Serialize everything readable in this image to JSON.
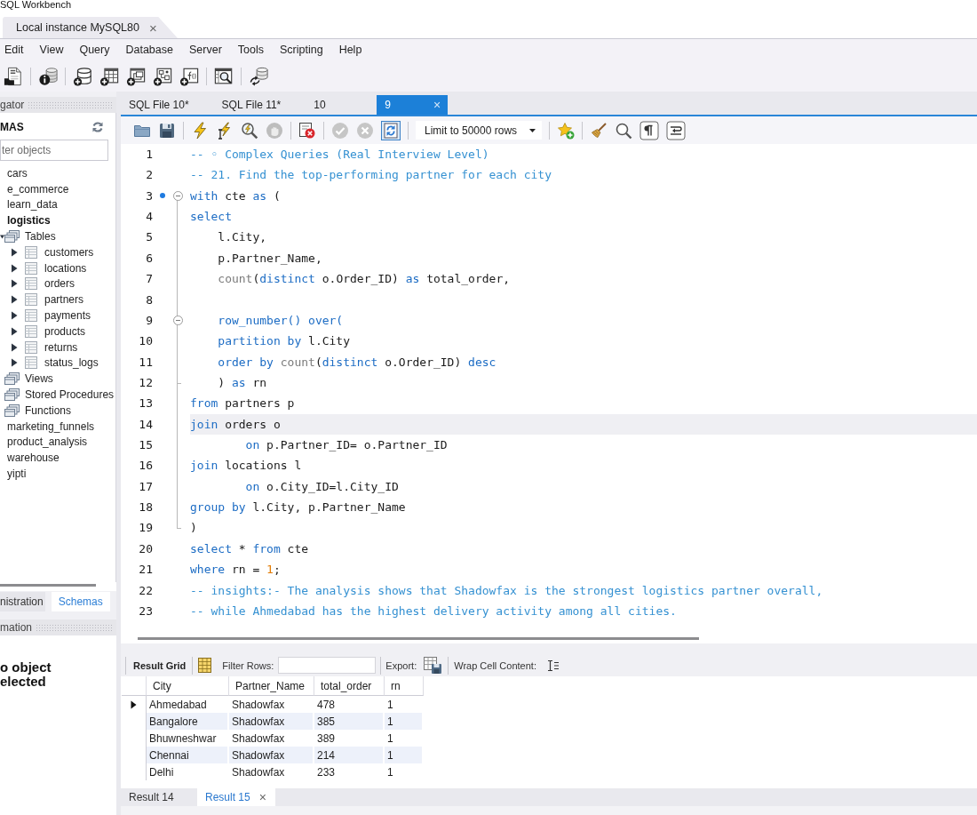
{
  "app": {
    "title": "SQL Workbench"
  },
  "connection_tabs": [
    {
      "label": "Local instance MySQL80",
      "close": "×",
      "selected": true
    }
  ],
  "menu": [
    "Edit",
    "View",
    "Query",
    "Database",
    "Server",
    "Tools",
    "Scripting",
    "Help"
  ],
  "navigator": {
    "header": "gator",
    "section": "MAS",
    "filter": {
      "placeholder": "ter objects"
    },
    "tree": [
      {
        "label": "cars",
        "kind": "schema",
        "default": false
      },
      {
        "label": "e_commerce",
        "kind": "schema",
        "default": false
      },
      {
        "label": "learn_data",
        "kind": "schema",
        "default": false
      },
      {
        "label": "logistics",
        "kind": "schema",
        "default": true,
        "children": [
          {
            "label": "Tables",
            "kind": "folder",
            "expanded": true,
            "children": [
              {
                "label": "customers",
                "kind": "table",
                "expanded": false
              },
              {
                "label": "locations",
                "kind": "table",
                "expanded": false
              },
              {
                "label": "orders",
                "kind": "table",
                "expanded": false
              },
              {
                "label": "partners",
                "kind": "table",
                "expanded": false
              },
              {
                "label": "payments",
                "kind": "table",
                "expanded": false
              },
              {
                "label": "products",
                "kind": "table",
                "expanded": false
              },
              {
                "label": "returns",
                "kind": "table",
                "expanded": false
              },
              {
                "label": "status_logs",
                "kind": "table",
                "expanded": false
              }
            ]
          },
          {
            "label": "Views",
            "kind": "folder"
          },
          {
            "label": "Stored Procedures",
            "kind": "folder"
          },
          {
            "label": "Functions",
            "kind": "folder"
          }
        ]
      },
      {
        "label": "marketing_funnels",
        "kind": "schema",
        "default": false
      },
      {
        "label": "product_analysis",
        "kind": "schema",
        "default": false
      },
      {
        "label": "warehouse",
        "kind": "schema",
        "default": false
      },
      {
        "label": "yipti",
        "kind": "schema",
        "default": false
      }
    ],
    "bottom_tabs": [
      {
        "label": "nistration",
        "selected": false
      },
      {
        "label": "Schemas",
        "selected": true
      }
    ],
    "info": {
      "header": "mation",
      "message": "o object elected"
    }
  },
  "editor_tabs": [
    {
      "label": "SQL File 10*",
      "selected": false
    },
    {
      "label": "SQL File 11*",
      "selected": false
    },
    {
      "label": "10",
      "selected": false
    },
    {
      "label": "9",
      "selected": true,
      "close": "×"
    }
  ],
  "editor_toolbar": {
    "executing": false,
    "autocommit": true,
    "limit": "Limit to 50000 rows"
  },
  "editor": {
    "lines": [
      {
        "number": "1",
        "kind": "plain",
        "marker": false,
        "current": false,
        "tokens": [
          {
            "kind": "comment",
            "text": "-- ◦ Complex Queries (Real Interview Level)"
          }
        ]
      },
      {
        "number": "2",
        "kind": "plain",
        "marker": false,
        "current": false,
        "tokens": [
          {
            "kind": "comment",
            "text": "-- 21. Find the top-performing partner for each city"
          }
        ]
      },
      {
        "number": "3",
        "kind": "open",
        "marker": true,
        "current": false,
        "tokens": [
          {
            "kind": "keyword",
            "text": "with"
          },
          {
            "kind": "plain",
            "text": " cte "
          },
          {
            "kind": "keyword",
            "text": "as"
          },
          {
            "kind": "plain",
            "text": " ("
          }
        ]
      },
      {
        "number": "4",
        "kind": "inner",
        "marker": false,
        "current": false,
        "tokens": [
          {
            "kind": "keyword",
            "text": "select"
          }
        ]
      },
      {
        "number": "5",
        "kind": "inner",
        "marker": false,
        "current": false,
        "tokens": [
          {
            "kind": "plain",
            "text": "    l.City,"
          }
        ]
      },
      {
        "number": "6",
        "kind": "inner",
        "marker": false,
        "current": false,
        "tokens": [
          {
            "kind": "plain",
            "text": "    p.Partner_Name,"
          }
        ]
      },
      {
        "number": "7",
        "kind": "inner",
        "marker": false,
        "current": false,
        "tokens": [
          {
            "kind": "function",
            "text": "    count"
          },
          {
            "kind": "plain",
            "text": "("
          },
          {
            "kind": "keyword",
            "text": "distinct"
          },
          {
            "kind": "plain",
            "text": " o.Order_ID) "
          },
          {
            "kind": "keyword",
            "text": "as"
          },
          {
            "kind": "plain",
            "text": " total_order,"
          }
        ]
      },
      {
        "number": "8",
        "kind": "inner",
        "marker": false
      },
      {
        "number": "9",
        "kind": "open",
        "marker": false,
        "current": false,
        "tokens": [
          {
            "kind": "keyword",
            "text": "    row_number() over("
          }
        ]
      },
      {
        "number": "10",
        "kind": "inner",
        "marker": false,
        "current": false,
        "tokens": [
          {
            "kind": "keyword",
            "text": "    partition by"
          },
          {
            "kind": "plain",
            "text": " l.City"
          }
        ]
      },
      {
        "number": "11",
        "kind": "inner",
        "marker": false,
        "current": false,
        "tokens": [
          {
            "kind": "keyword",
            "text": "    order by "
          },
          {
            "kind": "function",
            "text": "count"
          },
          {
            "kind": "plain",
            "text": "("
          },
          {
            "kind": "keyword",
            "text": "distinct"
          },
          {
            "kind": "plain",
            "text": " o.Order_ID) "
          },
          {
            "kind": "keyword",
            "text": "desc"
          }
        ]
      },
      {
        "number": "12",
        "kind": "close",
        "marker": false,
        "current": false,
        "tokens": [
          {
            "kind": "plain",
            "text": "    ) "
          },
          {
            "kind": "keyword",
            "text": "as"
          },
          {
            "kind": "plain",
            "text": " rn"
          }
        ]
      },
      {
        "number": "13",
        "kind": "inner",
        "marker": false,
        "current": false,
        "tokens": [
          {
            "kind": "keyword",
            "text": "from"
          },
          {
            "kind": "plain",
            "text": " partners p"
          }
        ]
      },
      {
        "number": "14",
        "kind": "inner",
        "marker": false,
        "current": true,
        "tokens": [
          {
            "kind": "keyword",
            "text": "join"
          },
          {
            "kind": "plain",
            "text": " orders o"
          }
        ]
      },
      {
        "number": "15",
        "kind": "inner",
        "marker": false,
        "current": false,
        "tokens": [
          {
            "kind": "keyword",
            "text": "        on"
          },
          {
            "kind": "plain",
            "text": " p.Partner_ID= o.Partner_ID"
          }
        ]
      },
      {
        "number": "16",
        "kind": "inner",
        "marker": false,
        "current": false,
        "tokens": [
          {
            "kind": "keyword",
            "text": "join"
          },
          {
            "kind": "plain",
            "text": " locations l"
          }
        ]
      },
      {
        "number": "17",
        "kind": "inner",
        "marker": false,
        "current": false,
        "tokens": [
          {
            "kind": "keyword",
            "text": "        on"
          },
          {
            "kind": "plain",
            "text": " o.City_ID=l.City_ID"
          }
        ]
      },
      {
        "number": "18",
        "kind": "inner",
        "marker": false,
        "current": false,
        "tokens": [
          {
            "kind": "keyword",
            "text": "group by"
          },
          {
            "kind": "plain",
            "text": " l.City, p.Partner_Name"
          }
        ]
      },
      {
        "number": "19",
        "kind": "close",
        "marker": false,
        "current": false,
        "tokens": [
          {
            "kind": "plain",
            "text": ")"
          }
        ]
      },
      {
        "number": "20",
        "kind": "plain",
        "marker": false,
        "current": false,
        "tokens": [
          {
            "kind": "keyword",
            "text": "select"
          },
          {
            "kind": "plain",
            "text": " * "
          },
          {
            "kind": "keyword",
            "text": "from"
          },
          {
            "kind": "plain",
            "text": " cte"
          }
        ]
      },
      {
        "number": "21",
        "kind": "plain",
        "marker": false,
        "current": false,
        "tokens": [
          {
            "kind": "keyword",
            "text": "where"
          },
          {
            "kind": "plain",
            "text": " rn = "
          },
          {
            "kind": "number",
            "text": "1"
          },
          {
            "kind": "plain",
            "text": ";"
          }
        ]
      },
      {
        "number": "22",
        "kind": "plain",
        "marker": false,
        "current": false,
        "tokens": [
          {
            "kind": "comment",
            "text": "-- insights:- The analysis shows that Shadowfax is the strongest logistics partner overall,"
          }
        ]
      },
      {
        "number": "23",
        "kind": "plain",
        "marker": false,
        "current": false,
        "tokens": [
          {
            "kind": "comment",
            "text": "-- while Ahmedabad has the highest delivery activity among all cities."
          }
        ]
      }
    ]
  },
  "results": {
    "toolbar": {
      "view": "Result Grid",
      "filter_label": "Filter Rows:",
      "export_label": "Export:",
      "wrap_label": "Wrap Cell Content:"
    },
    "columns": [
      "City",
      "Partner_Name",
      "total_order",
      "rn"
    ],
    "rows": [
      {
        "cells": [
          "Ahmedabad",
          "Shadowfax",
          "478",
          "1"
        ],
        "current": true
      },
      {
        "cells": [
          "Bangalore",
          "Shadowfax",
          "385",
          "1"
        ],
        "current": false
      },
      {
        "cells": [
          "Bhuwneshwar",
          "Shadowfax",
          "389",
          "1"
        ],
        "current": false
      },
      {
        "cells": [
          "Chennai",
          "Shadowfax",
          "214",
          "1"
        ],
        "current": false
      },
      {
        "cells": [
          "Delhi",
          "Shadowfax",
          "233",
          "1"
        ],
        "current": false
      }
    ],
    "tabs": [
      {
        "label": "Result 14",
        "selected": false
      },
      {
        "label": "Result 15",
        "selected": true,
        "close": "×"
      }
    ]
  }
}
